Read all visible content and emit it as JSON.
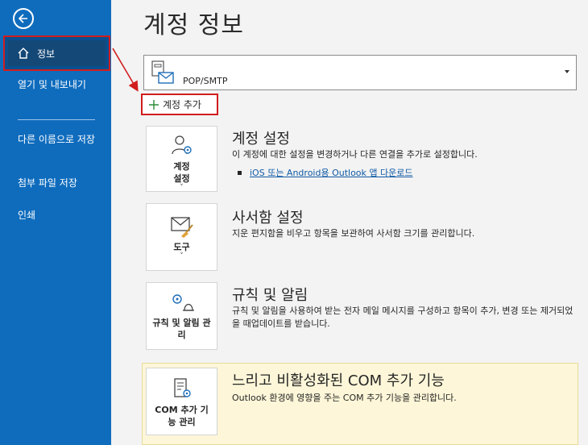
{
  "sidebar": {
    "back_icon": "arrow-left-icon",
    "items": [
      {
        "label": "정보",
        "icon": "home-icon",
        "selected": true
      },
      {
        "label": "열기 및 내보내기"
      },
      {
        "label": "다른 이름으로 저장"
      },
      {
        "label": "첨부 파일 저장"
      },
      {
        "label": "인쇄"
      }
    ]
  },
  "main": {
    "title": "계정 정보",
    "account": {
      "name": "POP/SMTP",
      "icon": "mailbox-icon"
    },
    "add_account_label": "계정 추가",
    "sections": [
      {
        "tile_label": "계정 설정",
        "icon": "account-settings-icon",
        "title": "계정 설정",
        "description": "이 계정에 대한 설정을 변경하거나 다른 연결을 추가로 설정합니다.",
        "link": "iOS 또는 Android용 Outlook 앱 다운로드"
      },
      {
        "tile_label": "도구",
        "icon": "mailbox-broom-icon",
        "title": "사서함 설정",
        "description": "지운 편지함을 비우고 항목을 보관하여 사서함 크기를 관리합니다."
      },
      {
        "tile_label": "규칙 및 알림 관리",
        "icon": "rules-alerts-icon",
        "title": "규칙 및 알림",
        "description": "규칙 및 알림을 사용하여 받는 전자 메일 메시지를 구성하고 항목이 추가, 변경 또는 제거되었을 때업데이트를 받습니다."
      },
      {
        "tile_label": "COM 추가 기능 관리",
        "icon": "com-addins-icon",
        "title": "느리고 비활성화된 COM 추가 기능",
        "description": "Outlook 환경에 영향을 주는 COM 추가 기능을 관리합니다."
      }
    ]
  },
  "colors": {
    "sidebar": "#0f6cbd",
    "highlight_border": "#d11d1d",
    "com_panel": "#fdf6d8",
    "link": "#0f5aa6"
  }
}
